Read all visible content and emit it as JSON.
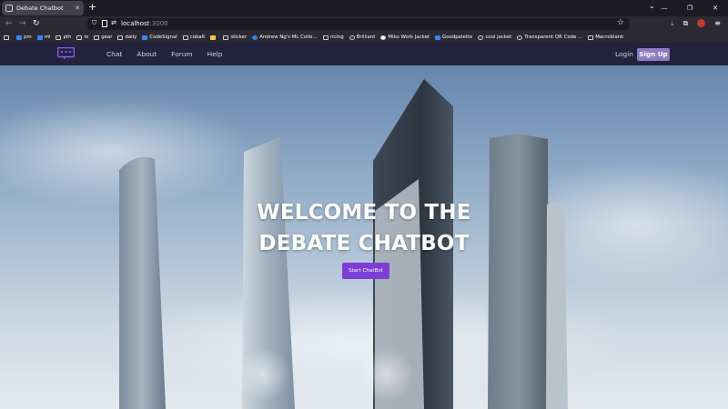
{
  "browser": {
    "tab_title": "Debate Chatbot",
    "url_host": "localhost",
    "url_port": ":3000",
    "bookmarks": [
      {
        "label": "",
        "icon": "bookmarks-toolbar-icon"
      },
      {
        "label": "pm",
        "icon": "bookmark-icon"
      },
      {
        "label": "ml",
        "icon": "bookmark-icon"
      },
      {
        "label": "pth",
        "icon": "folder-icon"
      },
      {
        "label": "io",
        "icon": "folder-icon"
      },
      {
        "label": "gear",
        "icon": "folder-icon"
      },
      {
        "label": "daily",
        "icon": "folder-icon"
      },
      {
        "label": "CodeSignal",
        "icon": "bookmark-icon"
      },
      {
        "label": "cobalt",
        "icon": "bookmark-icon"
      },
      {
        "label": "",
        "icon": "bookmark-icon"
      },
      {
        "label": "sticker",
        "icon": "folder-icon"
      },
      {
        "label": "Andrew Ng's ML Colle...",
        "icon": "bookmark-icon"
      },
      {
        "label": "ricing",
        "icon": "folder-icon"
      },
      {
        "label": "Brilliant",
        "icon": "bookmark-icon"
      },
      {
        "label": "Miko Work Jacket",
        "icon": "bookmark-icon"
      },
      {
        "label": "Goodpalette",
        "icon": "bookmark-icon"
      },
      {
        "label": "cool jacket",
        "icon": "bookmark-icon"
      },
      {
        "label": "Transparent QR Code ...",
        "icon": "bookmark-icon"
      },
      {
        "label": "Macroblank",
        "icon": "bookmark-icon"
      }
    ]
  },
  "site": {
    "nav": {
      "items": [
        "Chat",
        "About",
        "Forum",
        "Help"
      ],
      "login": "Login",
      "signup": "Sign Up"
    },
    "hero": {
      "line1": "WELCOME TO THE",
      "line2": "DEBATE CHATBOT",
      "cta": "Start ChatBot"
    }
  },
  "colors": {
    "site_nav_bg": "#23233e",
    "signup_bg": "#8e7cc3",
    "cta_bg": "#7b3fd6",
    "logo": "#8b5cf6"
  }
}
